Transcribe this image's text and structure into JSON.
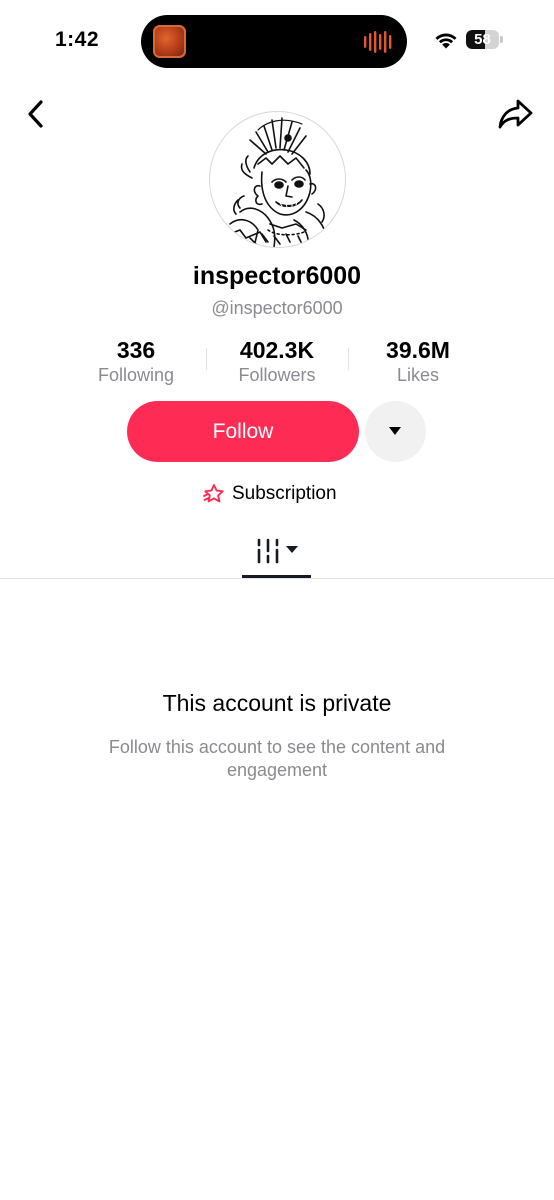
{
  "status_bar": {
    "time": "1:42",
    "battery_percent": "58",
    "battery_level": 0.58
  },
  "nav": {
    "back_icon": "chevron-left-icon",
    "share_icon": "share-arrow-icon"
  },
  "profile": {
    "display_name": "inspector6000",
    "handle": "@inspector6000"
  },
  "stats": [
    {
      "value": "336",
      "label": "Following"
    },
    {
      "value": "402.3K",
      "label": "Followers"
    },
    {
      "value": "39.6M",
      "label": "Likes"
    }
  ],
  "actions": {
    "follow_label": "Follow",
    "subscription_label": "Subscription"
  },
  "private_notice": {
    "title": "This account is private",
    "description": "Follow this account to see the content and engagement"
  },
  "colors": {
    "accent": "#fe2c55",
    "secondary_text": "#8a8b91"
  }
}
